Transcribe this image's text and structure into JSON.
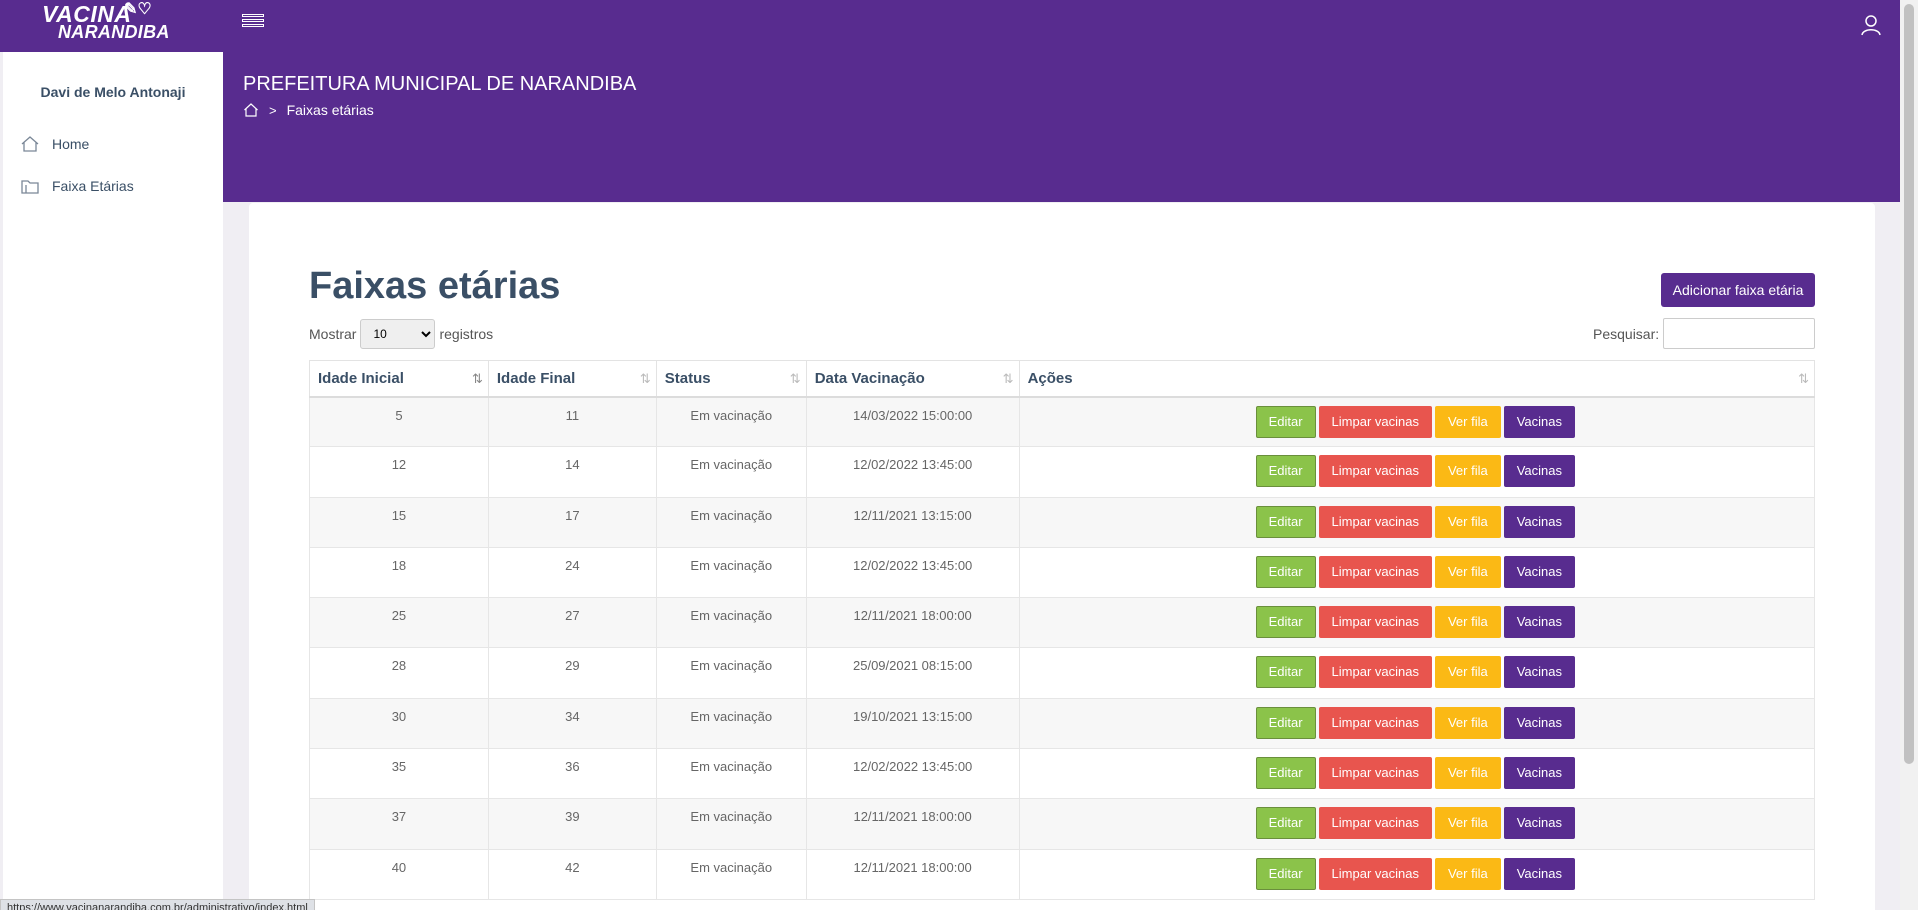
{
  "app": {
    "logo_line1": "VACINA",
    "logo_line2": "NARANDIBA",
    "logo_mark": "✎♡"
  },
  "sidebar": {
    "user_name": "Davi de Melo Antonaji",
    "items": [
      {
        "label": "Home",
        "icon": "home-icon"
      },
      {
        "label": "Faixa Etárias",
        "icon": "folder-icon"
      }
    ]
  },
  "header": {
    "title": "PREFEITURA MUNICIPAL DE NARANDIBA",
    "breadcrumb_current": "Faixas etárias",
    "breadcrumb_separator": ">"
  },
  "main": {
    "title": "Faixas etárias",
    "add_button": "Adicionar faixa etária",
    "show_label": "Mostrar",
    "show_value": "10",
    "records_label": "registros",
    "search_label": "Pesquisar:",
    "search_value": "",
    "columns": [
      "Idade Inicial",
      "Idade Final",
      "Status",
      "Data Vacinação",
      "Ações"
    ],
    "sort_icon": "⇅",
    "action_labels": {
      "edit": "Editar",
      "clear": "Limpar vacinas",
      "queue": "Ver fila",
      "vaccines": "Vacinas"
    },
    "rows": [
      [
        "5",
        "11",
        "Em vacinação",
        "14/03/2022 15:00:00"
      ],
      [
        "12",
        "14",
        "Em vacinação",
        "12/02/2022 13:45:00"
      ],
      [
        "15",
        "17",
        "Em vacinação",
        "12/11/2021 13:15:00"
      ],
      [
        "18",
        "24",
        "Em vacinação",
        "12/02/2022 13:45:00"
      ],
      [
        "25",
        "27",
        "Em vacinação",
        "12/11/2021 18:00:00"
      ],
      [
        "28",
        "29",
        "Em vacinação",
        "25/09/2021 08:15:00"
      ],
      [
        "30",
        "34",
        "Em vacinação",
        "19/10/2021 13:15:00"
      ],
      [
        "35",
        "36",
        "Em vacinação",
        "12/02/2022 13:45:00"
      ],
      [
        "37",
        "39",
        "Em vacinação",
        "12/11/2021 18:00:00"
      ],
      [
        "40",
        "42",
        "Em vacinação",
        "12/11/2021 18:00:00"
      ]
    ]
  },
  "status_bar": {
    "url": "https://www.vacinanarandiba.com.br/administrativo/index.html"
  },
  "colors": {
    "brand_purple": "#582c8f",
    "edit_green": "#8bc34a",
    "clear_red": "#e8554e",
    "queue_yellow": "#fbb915"
  }
}
